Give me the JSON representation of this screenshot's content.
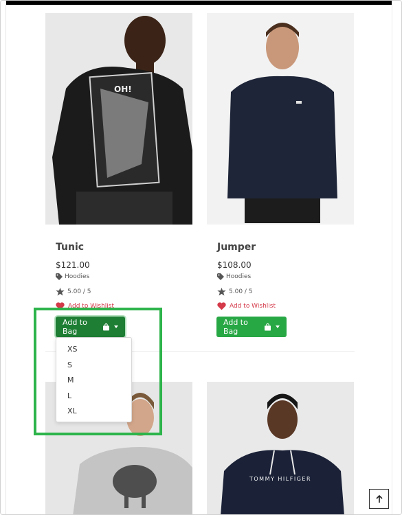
{
  "products": [
    {
      "name": "Tunic",
      "price": "$121.00",
      "category": "Hoodies",
      "rating": "5.00 / 5",
      "wishlist": "Add to Wishlist",
      "bag": "Add to Bag"
    },
    {
      "name": "Jumper",
      "price": "$108.00",
      "category": "Hoodies",
      "rating": "5.00 / 5",
      "wishlist": "Add to Wishlist",
      "bag": "Add to Bag"
    }
  ],
  "size_menu": {
    "options": [
      "XS",
      "S",
      "M",
      "L",
      "XL"
    ]
  },
  "tommy_logo": "TOMMY HILFIGER",
  "colors": {
    "accent_green": "#28a745",
    "wishlist_red": "#d43a4a",
    "highlight_green": "#2db44b"
  },
  "icons": {
    "tag": "tag-icon",
    "star": "star-icon",
    "heart": "heart-icon",
    "bag": "shopping-bag-icon",
    "up": "arrow-up-icon"
  }
}
